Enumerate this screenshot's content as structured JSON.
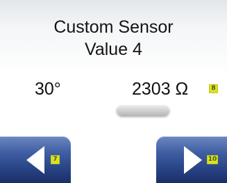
{
  "screen": {
    "title_line1": "Custom Sensor",
    "title_line2": "Value 4"
  },
  "reading": {
    "temperature": "30°",
    "resistance": "2303  Ω",
    "resistance_badge": "8"
  },
  "navigation": {
    "back_icon": "left-arrow-icon",
    "back_badge": "7",
    "next_icon": "right-arrow-icon",
    "next_badge": "10"
  },
  "colors": {
    "badge": "#d8e027",
    "button": "#2d4a8c",
    "arrow": "#ffffff"
  }
}
